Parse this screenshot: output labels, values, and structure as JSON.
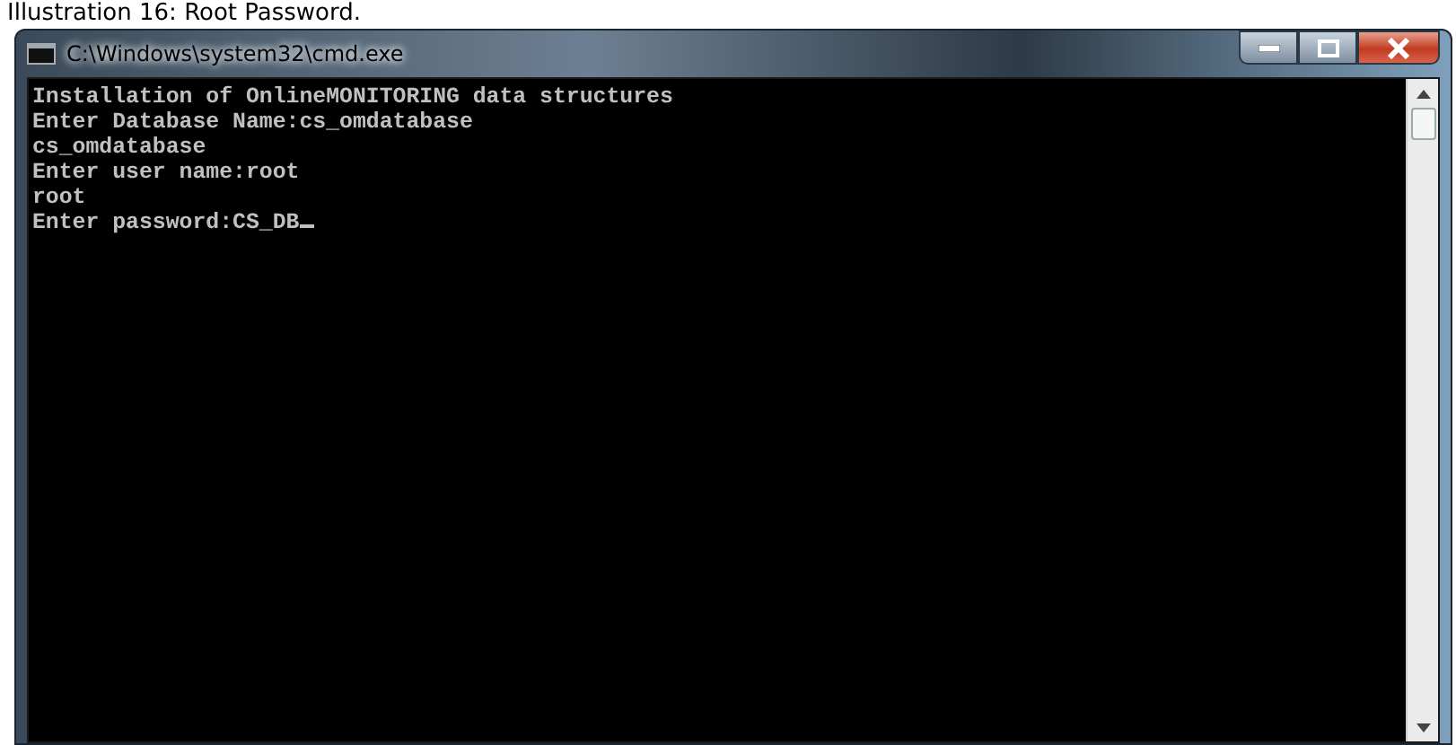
{
  "caption": "Illustration 16: Root Password.",
  "window": {
    "title": "C:\\Windows\\system32\\cmd.exe"
  },
  "console": {
    "lines": [
      "Installation of OnlineMONITORING data structures",
      "Enter Database Name:cs_omdatabase",
      "cs_omdatabase",
      "Enter user name:root",
      "root",
      "Enter password:CS_DB"
    ]
  }
}
